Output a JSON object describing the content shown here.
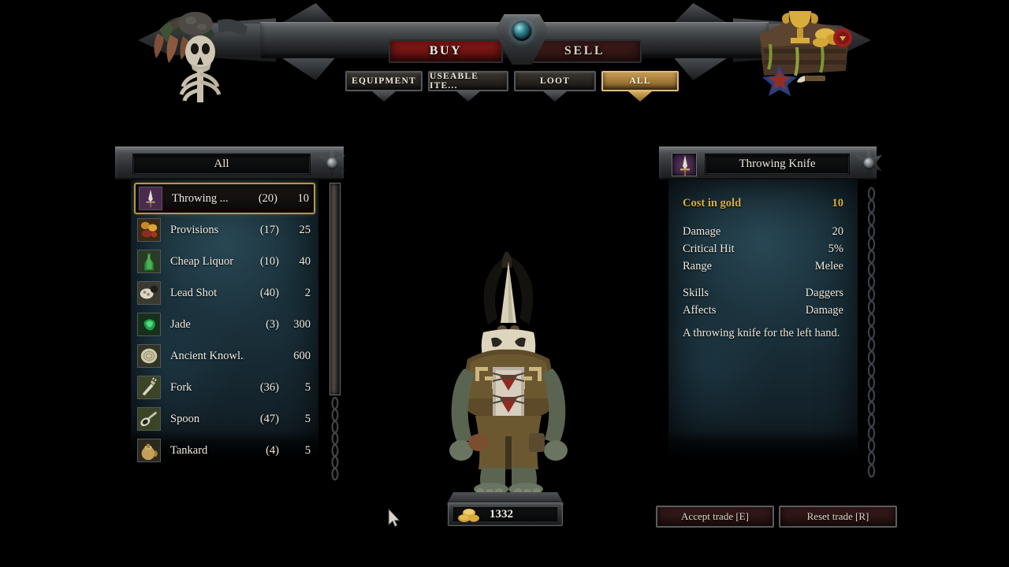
{
  "banner": {
    "mode_buttons": [
      {
        "label": "BUY",
        "active": true
      },
      {
        "label": "SELL",
        "active": false
      }
    ],
    "tabs": [
      {
        "label": "EQUIPMENT",
        "active": false
      },
      {
        "label": "USEABLE ITE...",
        "active": false
      },
      {
        "label": "LOOT",
        "active": false
      },
      {
        "label": "ALL",
        "active": true
      }
    ],
    "center_gem": "gem-icon",
    "left_ornament": "skeleton-ornament",
    "right_ornament": "treasure-chest-ornament"
  },
  "list_panel": {
    "title": "All",
    "items": [
      {
        "name": "Throwing ...",
        "qty": "(20)",
        "price": "10",
        "icon": "dagger-icon",
        "selected": true
      },
      {
        "name": "Provisions",
        "qty": "(17)",
        "price": "25",
        "icon": "food-icon",
        "selected": false
      },
      {
        "name": "Cheap Liquor",
        "qty": "(10)",
        "price": "40",
        "icon": "bottle-icon",
        "selected": false
      },
      {
        "name": "Lead Shot",
        "qty": "(40)",
        "price": "2",
        "icon": "shot-icon",
        "selected": false
      },
      {
        "name": "Jade",
        "qty": "(3)",
        "price": "300",
        "icon": "gem-icon",
        "selected": false
      },
      {
        "name": "Ancient Knowl...",
        "qty": "",
        "price": "600",
        "icon": "scroll-icon",
        "selected": false
      },
      {
        "name": "Fork",
        "qty": "(36)",
        "price": "5",
        "icon": "fork-icon",
        "selected": false
      },
      {
        "name": "Spoon",
        "qty": "(47)",
        "price": "5",
        "icon": "spoon-icon",
        "selected": false
      },
      {
        "name": "Tankard",
        "qty": "(4)",
        "price": "5",
        "icon": "tankard-icon",
        "selected": false
      }
    ]
  },
  "detail_panel": {
    "title": "Throwing Knife",
    "icon": "dagger-icon",
    "cost_label": "Cost in gold",
    "cost_value": "10",
    "stats": [
      {
        "label": "Damage",
        "value": "20"
      },
      {
        "label": "Critical Hit",
        "value": "5%"
      },
      {
        "label": "Range",
        "value": "Melee"
      }
    ],
    "meta": [
      {
        "label": "Skills",
        "value": "Daggers"
      },
      {
        "label": "Affects",
        "value": "Damage"
      }
    ],
    "description": "A throwing knife for the left hand."
  },
  "footer": {
    "gold": "1332",
    "accept_label": "Accept trade [E]",
    "reset_label": "Reset trade [R]"
  },
  "colors": {
    "buy_red": "#9e1d1c",
    "tab_active_gold": "#c99f55",
    "selection_gold": "#b99647",
    "cost_gold": "#d8ad3e",
    "parchment_teal": "#1b323c"
  }
}
